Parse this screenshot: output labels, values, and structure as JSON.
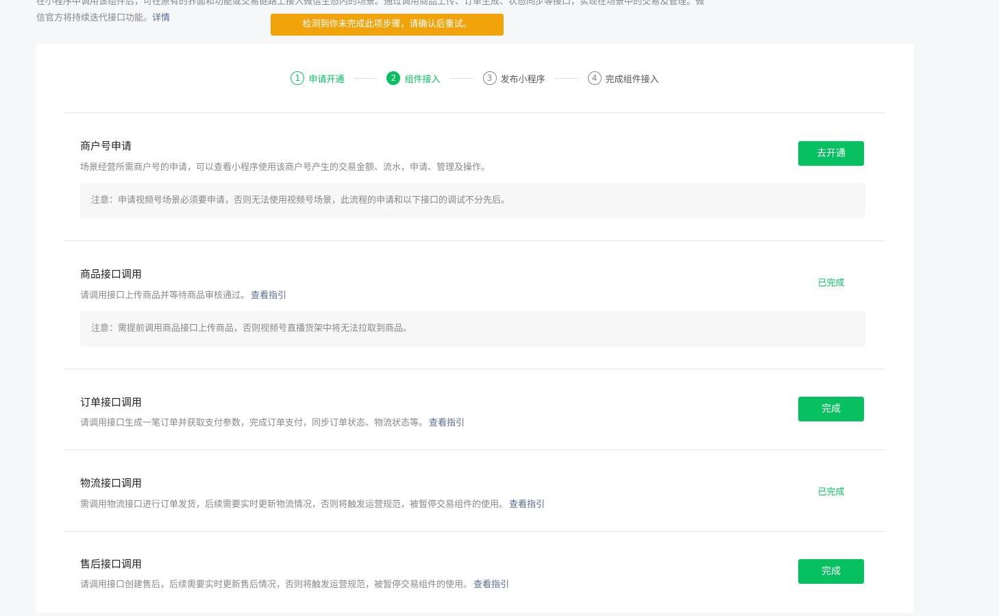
{
  "intro": {
    "line1": "在小程序中调用该组件后，可在原有的界面和功能或交易链路上接入微信生态内的场景。通过调用商品上传、订单生成、状态同步等接口，实现在场景中的交易及管理。微",
    "line2": "信官方将持续迭代接口功能。",
    "link": "详情"
  },
  "toast": "检测到你未完成此项步骤，请确认后重试。",
  "steps": [
    {
      "num": "1",
      "label": "申请开通"
    },
    {
      "num": "2",
      "label": "组件接入"
    },
    {
      "num": "3",
      "label": "发布小程序"
    },
    {
      "num": "4",
      "label": "完成组件接入"
    }
  ],
  "sections": [
    {
      "title": "商户号申请",
      "desc": "场景经营所需商户号的申请，可以查看小程序使用该商户号产生的交易金额、流水，申请、管理及操作。",
      "note": "注意：申请视频号场景必须要申请，否则无法使用视频号场景，此流程的申请和以下接口的调试不分先后。",
      "action": "去开通"
    },
    {
      "title": "商品接口调用",
      "desc": "请调用接口上传商品并等待商品审核通过。",
      "link": "查看指引",
      "note": "注意：需提前调用商品接口上传商品，否则视频号直播货架中将无法拉取到商品。",
      "status": "已完成"
    },
    {
      "title": "订单接口调用",
      "desc": "请调用接口生成一笔订单并获取支付参数，完成订单支付，同步订单状态、物流状态等。",
      "link": "查看指引",
      "action": "完成"
    },
    {
      "title": "物流接口调用",
      "desc": "需调用物流接口进行订单发货，后续需要实时更新物流情况，否则将触发运营规范，被暂停交易组件的使用。",
      "link": "查看指引",
      "status": "已完成"
    },
    {
      "title": "售后接口调用",
      "desc": "请调用接口创建售后，后续需要实时更新售后情况，否则将触发运营规范，被暂停交易组件的使用。",
      "link": "查看指引",
      "action": "完成"
    }
  ],
  "colors": {
    "primary": "#07c160",
    "warning": "#f0a30a",
    "link": "#576b95"
  }
}
